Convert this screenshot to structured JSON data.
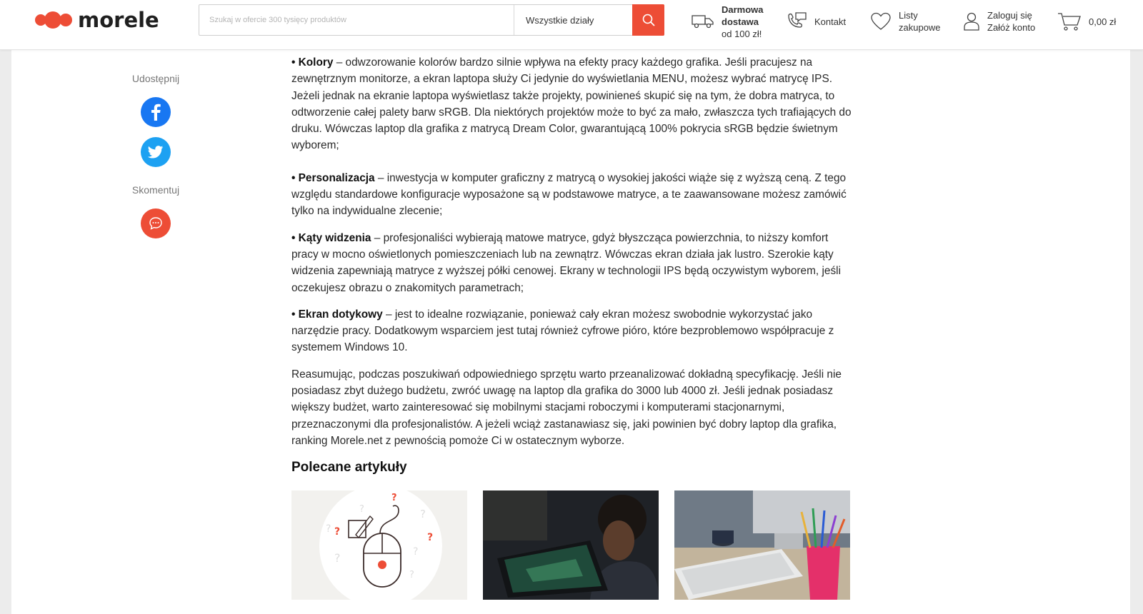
{
  "header": {
    "logo_text": "morele",
    "search": {
      "placeholder": "Szukaj w ofercie 300 tysięcy produktów",
      "category": "Wszystkie działy"
    },
    "delivery": {
      "line1": "Darmowa",
      "line2": "dostawa",
      "line3": "od 100 zł!"
    },
    "contact_label": "Kontakt",
    "lists": {
      "line1": "Listy",
      "line2": "zakupowe"
    },
    "login": {
      "line1": "Zaloguj się",
      "line2": "Załóż konto"
    },
    "cart_total": "0,00 zł"
  },
  "share": {
    "share_label": "Udostępnij",
    "comment_label": "Skomentuj"
  },
  "article": {
    "items": [
      {
        "title": "• Kolory",
        "text": " – odwzorowanie kolorów bardzo silnie wpływa na efekty pracy każdego grafika. Jeśli pracujesz na zewnętrznym monitorze, a ekran laptopa służy Ci jedynie do wyświetlania MENU, możesz wybrać matrycę IPS. Jeżeli jednak na ekranie laptopa wyświetlasz także projekty, powinieneś skupić się na tym, że dobra matryca, to odtworzenie całej palety barw sRGB. Dla niektórych projektów może to być za mało, zwłaszcza tych trafiających do druku. Wówczas laptop dla grafika z matrycą Dream Color, gwarantującą 100% pokrycia sRGB będzie świetnym wyborem;"
      },
      {
        "title": "• Personalizacja",
        "text": " – inwestycja w komputer graficzny z matrycą o wysokiej jakości wiąże się z wyższą ceną. Z tego względu standardowe konfiguracje wyposażone są w podstawowe matryce, a te zaawansowane możesz zamówić tylko na indywidualne zlecenie;"
      },
      {
        "title": "• Kąty widzenia",
        "text": " – profesjonaliści wybierają matowe matryce, gdyż błyszcząca powierzchnia, to niższy komfort pracy w mocno oświetlonych pomieszczeniach lub na zewnątrz. Wówczas ekran działa jak lustro. Szerokie kąty widzenia zapewniają matryce z wyższej półki cenowej. Ekrany w technologii IPS będą oczywistym wyborem, jeśli oczekujesz obrazu o znakomitych parametrach;"
      },
      {
        "title": "• Ekran dotykowy",
        "text": " – jest to idealne rozwiązanie, ponieważ cały ekran możesz swobodnie wykorzystać jako narzędzie pracy. Dodatkowym wsparciem jest tutaj również cyfrowe pióro, które bezproblemowo współpracuje z systemem Windows 10."
      }
    ],
    "summary": "Reasumując, podczas poszukiwań odpowiedniego sprzętu warto przeanalizować dokładną specyfikację. Jeśli nie posiadasz zbyt dużego budżetu, zwróć uwagę na laptop dla grafika do 3000 lub 4000 zł. Jeśli jednak posiadasz większy budżet, warto zainteresować się mobilnymi stacjami roboczymi i komputerami stacjonarnymi, przeznaczonymi dla profesjonalistów. A jeżeli wciąż zastanawiasz się, jaki powinien być dobry laptop dla grafika, ranking Morele.net z pewnością pomoże Ci w ostatecznym wyborze.",
    "recommended_heading": "Polecane artykuły"
  },
  "colors": {
    "brand": "#ed4d36",
    "facebook": "#1877f2",
    "twitter": "#1da1f2"
  }
}
